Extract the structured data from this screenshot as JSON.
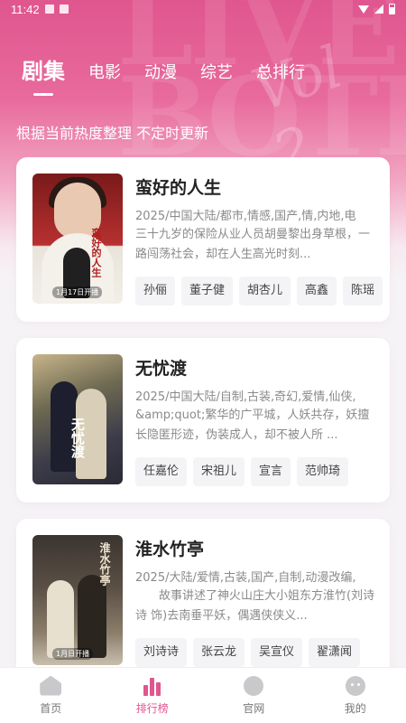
{
  "status_bar": {
    "time": "11:42"
  },
  "tabs": [
    {
      "label": "剧集",
      "active": true
    },
    {
      "label": "电影",
      "active": false
    },
    {
      "label": "动漫",
      "active": false
    },
    {
      "label": "综艺",
      "active": false
    },
    {
      "label": "总排行",
      "active": false
    }
  ],
  "subtitle": "根据当前热度整理 不定时更新",
  "cards": [
    {
      "title": "蛮好的人生",
      "meta": "2025/中国大陆/都市,情感,国产,情,内地,电",
      "desc": "三十九岁的保险从业人员胡曼黎出身草根，一路闯荡社会，却在人生高光时刻...",
      "poster_title": "蛮好的人生",
      "poster_badge": "1月17日开播",
      "actors": [
        "孙俪",
        "董子健",
        "胡杏儿",
        "高鑫",
        "陈瑶"
      ]
    },
    {
      "title": "无忧渡",
      "meta": "2025/中国大陆/自制,古装,奇幻,爱情,仙侠,",
      "desc": "&amp;quot;繁华的广平城，人妖共存，妖擅长隐匿形迹，伪装成人，却不被人所 ...",
      "poster_title": "无忧渡",
      "poster_badge": "",
      "actors": [
        "任嘉伦",
        "宋祖儿",
        "宣言",
        "范帅琦"
      ]
    },
    {
      "title": "淮水竹亭",
      "meta": "2025/大陆/爱情,古装,国产,自制,动漫改编,",
      "desc": "　　故事讲述了神火山庄大小姐东方淮竹(刘诗诗 饰)去南垂平妖，偶遇侠侠义...",
      "poster_title": "淮水竹亭",
      "poster_badge": "1月日开播",
      "actors": [
        "刘诗诗",
        "张云龙",
        "吴宣仪",
        "翟潇闻"
      ]
    }
  ],
  "bottom_nav": [
    {
      "label": "首页",
      "icon": "home-icon",
      "active": false
    },
    {
      "label": "排行榜",
      "icon": "rank-icon",
      "active": true
    },
    {
      "label": "官网",
      "icon": "official-icon",
      "active": false
    },
    {
      "label": "我的",
      "icon": "mine-icon",
      "active": false
    }
  ],
  "colors": {
    "accent": "#e0568f",
    "hero": "#e86a9c"
  }
}
